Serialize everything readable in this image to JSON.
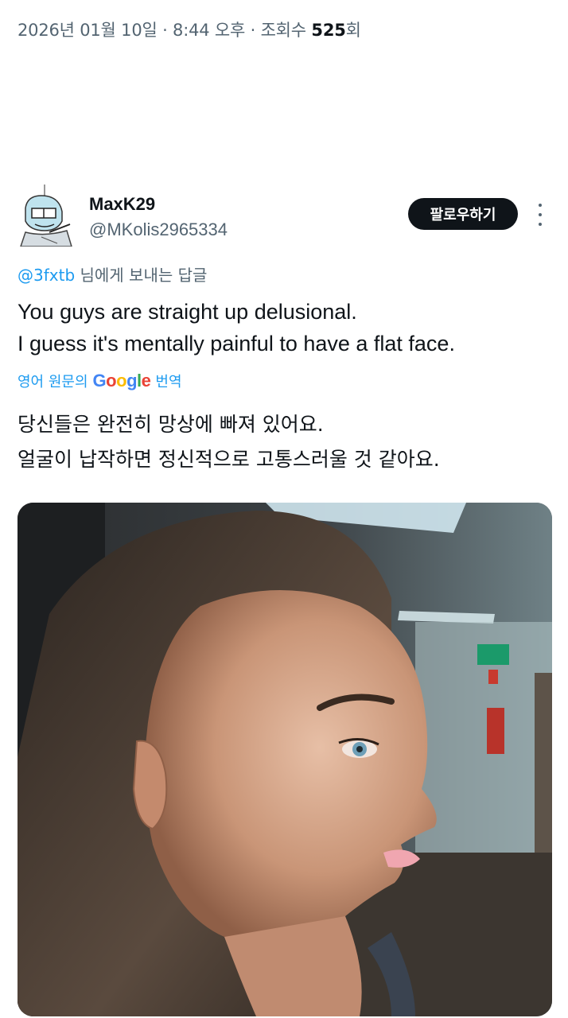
{
  "meta": {
    "date": "2026년 01월 10일",
    "sep1": " · ",
    "time": "8:44 오후",
    "sep2": " · ",
    "views_label": "조회수 ",
    "views_count": "525",
    "views_suffix": "회"
  },
  "author": {
    "name": "MaxK29",
    "handle": "@MKolis2965334",
    "avatar_icon": "avatar-sketch-icon"
  },
  "follow_button": {
    "label": "팔로우하기"
  },
  "more_menu": {
    "icon": "more-vertical-icon"
  },
  "reply": {
    "mention": "@3fxtb",
    "text": " 님에게 보내는 답글"
  },
  "tweet": {
    "line1": "You guys are straight up delusional.",
    "line2": "I guess it's mentally painful to have a flat face."
  },
  "translation": {
    "prefix": "영어 원문의",
    "google_letters": [
      "G",
      "o",
      "o",
      "g",
      "l",
      "e"
    ],
    "google_colors": [
      "#4285F4",
      "#EA4335",
      "#FBBC05",
      "#4285F4",
      "#34A853",
      "#EA4335"
    ],
    "suffix": "번역",
    "line1": "당신들은 완전히 망상에 빠져 있어요.",
    "line2": "얼굴이 납작하면 정신적으로 고통스러울 것 같아요."
  },
  "colors": {
    "accent": "#1d9bf0",
    "text": "#0f1419",
    "secondary": "#536471",
    "button_bg": "#0f1419"
  }
}
